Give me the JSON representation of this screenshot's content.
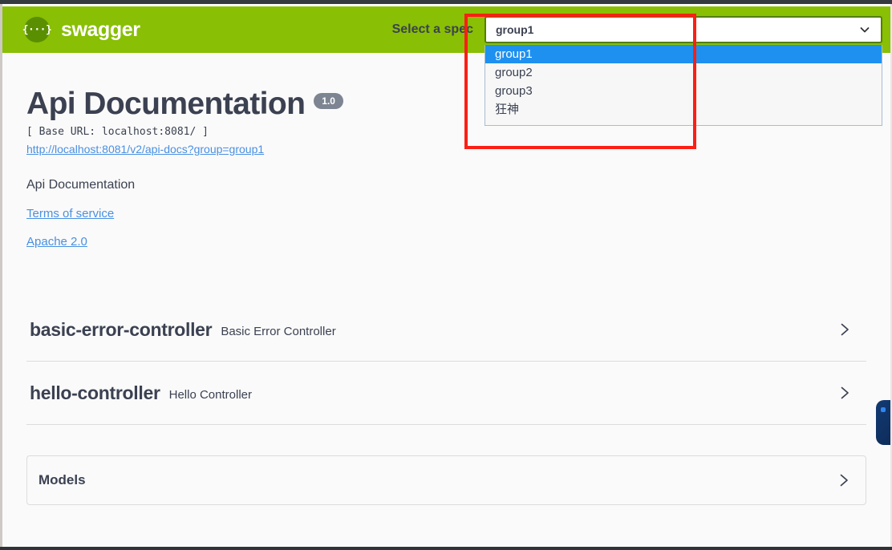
{
  "topbar": {
    "logo_text": "swagger",
    "logo_icon": "swagger-braces-icon",
    "spec_label": "Select a spec",
    "select": {
      "value": "group1",
      "caret_icon": "chevron-down-icon",
      "options": [
        "group1",
        "group2",
        "group3",
        "狂神"
      ],
      "selected_index": 0
    }
  },
  "info": {
    "title": "Api Documentation",
    "version": "1.0",
    "base_url": "[ Base URL: localhost:8081/ ]",
    "docs_url": "http://localhost:8081/v2/api-docs?group=group1",
    "description": "Api Documentation",
    "terms_link": "Terms of service",
    "license_link": "Apache 2.0"
  },
  "tags": [
    {
      "name": "basic-error-controller",
      "description": "Basic Error Controller",
      "expand_icon": "chevron-right-icon"
    },
    {
      "name": "hello-controller",
      "description": "Hello Controller",
      "expand_icon": "chevron-right-icon"
    }
  ],
  "models": {
    "title": "Models",
    "expand_icon": "chevron-right-icon"
  },
  "annotation": {
    "type": "highlight-rectangle",
    "color": "#fb1f15"
  },
  "colors": {
    "brand_green": "#89bf04",
    "select_border_green": "#547f00",
    "option_highlight_blue": "#1e90f0",
    "link_blue": "#4990e2",
    "text_dark": "#3b4151",
    "version_badge_grey": "#7d8492",
    "page_background": "#fafafa"
  }
}
